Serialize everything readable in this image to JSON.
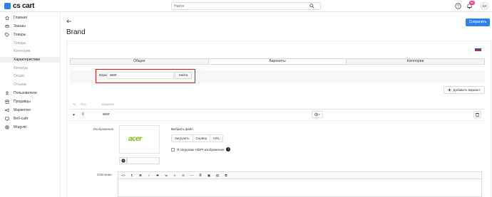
{
  "header": {
    "logo_text": "cs cart",
    "search_placeholder": "Найти",
    "notifications_count": "60",
    "avatar_initials": "AA"
  },
  "sidebar": {
    "items": [
      {
        "label": "Главная",
        "icon": "home-icon"
      },
      {
        "label": "Заказы",
        "icon": "orders-icon"
      },
      {
        "label": "Товары",
        "icon": "tag-icon"
      },
      {
        "label": "Товары",
        "sub": true
      },
      {
        "label": "Категории",
        "sub": true
      },
      {
        "label": "Характеристики",
        "sub": true,
        "active": true
      },
      {
        "label": "Фильтры",
        "sub": true
      },
      {
        "label": "Опции",
        "sub": true
      },
      {
        "label": "Отзывы",
        "sub": true
      },
      {
        "label": "Пользователи",
        "icon": "user-icon"
      },
      {
        "label": "Продавцы",
        "icon": "store-icon"
      },
      {
        "label": "Маркетинг",
        "icon": "megaphone-icon"
      },
      {
        "label": "Веб-сайт",
        "icon": "globe-icon"
      },
      {
        "label": "Модули",
        "icon": "puzzle-icon"
      }
    ]
  },
  "page": {
    "title": "Brand",
    "save_label": "Сохранить"
  },
  "tabs": [
    {
      "label": "Общее",
      "active": false
    },
    {
      "label": "Варианты",
      "active": true
    },
    {
      "label": "Категории",
      "active": false
    }
  ],
  "filter": {
    "label": "Вариант",
    "value": "acer",
    "button": "Найти"
  },
  "add_variant_label": "Добавить вариант",
  "table": {
    "headers": {
      "position": "Поз",
      "variant": "Вариант"
    },
    "row": {
      "position": "0",
      "name": "acer"
    }
  },
  "variant_details": {
    "image_label": "Изображение",
    "logo_text": "acer",
    "choose_file": "Выбрать файл",
    "upload_buttons": [
      "Загрузить",
      "Сервер",
      "URL"
    ],
    "hidpi_label": "Я загружаю HiDPI-изображение",
    "description_label": "Описание",
    "toolbar": [
      "<>",
      "¶",
      "B",
      "I",
      "S",
      "≔",
      "≡",
      "⊝",
      "—",
      "≣",
      "▣",
      "▤",
      "⧉"
    ]
  },
  "colors": {
    "accent": "#2f80ed",
    "highlight_border": "#d71a1a",
    "badge": "#e33e8b",
    "acer_green": "#83b81a"
  }
}
